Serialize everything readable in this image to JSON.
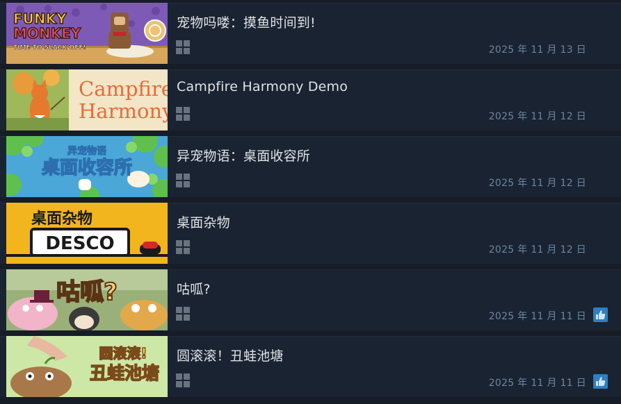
{
  "items": [
    {
      "title": "宠物吗喽：摸鱼时间到!",
      "date": "2025 年 11 月 13 日",
      "thumb": false,
      "capsule": {
        "line1": "FUNKY",
        "line2": "MONKEY",
        "line3": "TIME TO SLACK OFF!",
        "bg": "#7e5ab7"
      }
    },
    {
      "title": "Campfire Harmony Demo",
      "date": "2025 年 11 月 12 日",
      "thumb": false,
      "capsule": {
        "line1": "Campfire",
        "line2": "Harmony",
        "bg": "#f3e6c6"
      }
    },
    {
      "title": "异宠物语：桌面收容所",
      "date": "2025 年 11 月 12 日",
      "thumb": false,
      "capsule": {
        "line1": "异宠物语",
        "line2": "桌面收容所",
        "bg": "#4aa7d8"
      }
    },
    {
      "title": "桌面杂物",
      "date": "2025 年 11 月 12 日",
      "thumb": false,
      "capsule": {
        "line1": "桌面杂物",
        "line2": "DESCO",
        "bg": "#f2b51e"
      }
    },
    {
      "title": "咕呱?",
      "date": "2025 年 11 月 11 日",
      "thumb": true,
      "capsule": {
        "line1": "咕呱?",
        "bg": "#9ab079"
      }
    },
    {
      "title": "圆滚滚！丑蛙池塘",
      "date": "2025 年 11 月 11 日",
      "thumb": true,
      "capsule": {
        "line1": "圆滚滚!",
        "line2": "丑蛙池塘",
        "bg": "#cde7a6"
      }
    }
  ],
  "icons": {
    "platform": "windows-icon",
    "review": "thumbs-up-icon"
  },
  "colors": {
    "row_bg": "#1a2331",
    "title": "#dfe3e7",
    "date": "#6b87a5",
    "thumb": "#5aa9e6"
  }
}
